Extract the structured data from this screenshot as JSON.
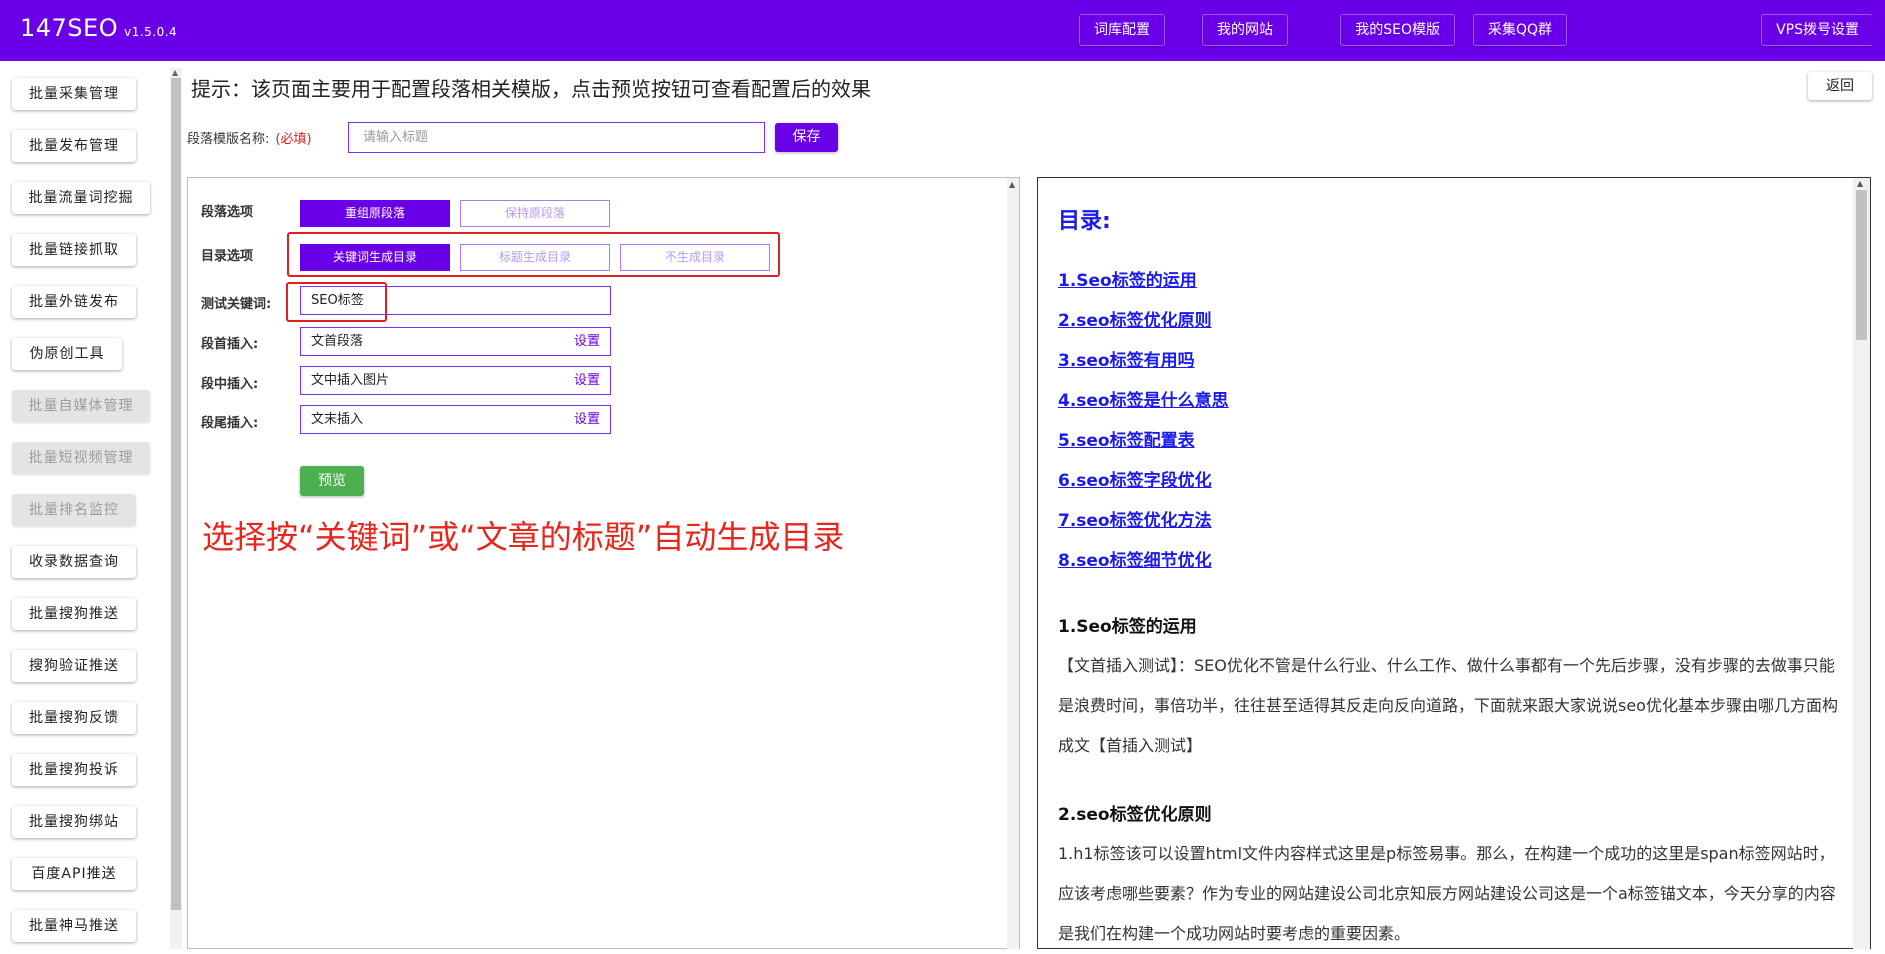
{
  "header": {
    "brand": "147SEO",
    "version": "v1.5.0.4",
    "nav": [
      "词库配置",
      "我的网站",
      "我的SEO模版",
      "采集QQ群",
      "VPS拨号设置"
    ]
  },
  "sidebar": {
    "items": [
      {
        "label": "批量采集管理",
        "disabled": false
      },
      {
        "label": "批量发布管理",
        "disabled": false
      },
      {
        "label": "批量流量词挖掘",
        "disabled": false
      },
      {
        "label": "批量链接抓取",
        "disabled": false
      },
      {
        "label": "批量外链发布",
        "disabled": false
      },
      {
        "label": "伪原创工具",
        "disabled": false
      },
      {
        "label": "批量自媒体管理",
        "disabled": true
      },
      {
        "label": "批量短视频管理",
        "disabled": true
      },
      {
        "label": "批量排名监控",
        "disabled": true
      },
      {
        "label": "收录数据查询",
        "disabled": false
      },
      {
        "label": "批量搜狗推送",
        "disabled": false
      },
      {
        "label": "搜狗验证推送",
        "disabled": false
      },
      {
        "label": "批量搜狗反馈",
        "disabled": false
      },
      {
        "label": "批量搜狗投诉",
        "disabled": false
      },
      {
        "label": "批量搜狗绑站",
        "disabled": false
      },
      {
        "label": "百度API推送",
        "disabled": false
      },
      {
        "label": "批量神马推送",
        "disabled": false
      }
    ]
  },
  "main": {
    "tip": "提示：该页面主要用于配置段落相关模版，点击预览按钮可查看配置后的效果",
    "back_label": "返回",
    "name_label": "段落模版名称:",
    "name_required": "(必填)",
    "name_placeholder": "请输入标题",
    "save_label": "保存",
    "paragraph_label": "段落选项",
    "paragraph_options": [
      "重组原段落",
      "保持原段落"
    ],
    "toc_label": "目录选项",
    "toc_options": [
      "关键词生成目录",
      "标题生成目录",
      "不生成目录"
    ],
    "keyword_label": "测试关键词:",
    "keyword_value": "SEO标签",
    "insert_rows": [
      {
        "label": "段首插入:",
        "value": "文首段落",
        "action": "设置"
      },
      {
        "label": "段中插入:",
        "value": "文中插入图片",
        "action": "设置"
      },
      {
        "label": "段尾插入:",
        "value": "文末插入",
        "action": "设置"
      }
    ],
    "preview_label": "预览",
    "annotation": "选择按“关键词”或“文章的标题”自动生成目录"
  },
  "preview": {
    "toc_title": "目录:",
    "toc": [
      "1.Seo标签的运用",
      "2.seo标签优化原则",
      "3.seo标签有用吗",
      "4.seo标签是什么意思",
      "5.seo标签配置表",
      "6.seo标签字段优化",
      "7.seo标签优化方法",
      "8.seo标签细节优化"
    ],
    "sections": [
      {
        "heading": "1.Seo标签的运用",
        "body": "【文首插入测试】：SEO优化不管是什么行业、什么工作、做什么事都有一个先后步骤，没有步骤的去做事只能是浪费时间，事倍功半，往往甚至适得其反走向反向道路，下面就来跟大家说说seo优化基本步骤由哪几方面构成文【首插入测试】"
      },
      {
        "heading": "2.seo标签优化原则",
        "body": "1.h1标签该可以设置html文件内容样式这里是p标签易事。那么，在构建一个成功的这里是span标签网站时，应该考虑哪些要素？作为专业的网站建设公司北京知辰方网站建设公司这是一个a标签锚文本，今天分享的内容是我们在构建一个成功网站时要考虑的重要因素。"
      }
    ]
  },
  "colors": {
    "accent": "#6a00e8",
    "annotation": "#e8261c",
    "link": "#1a1aee",
    "preview_button": "#4caf50"
  }
}
